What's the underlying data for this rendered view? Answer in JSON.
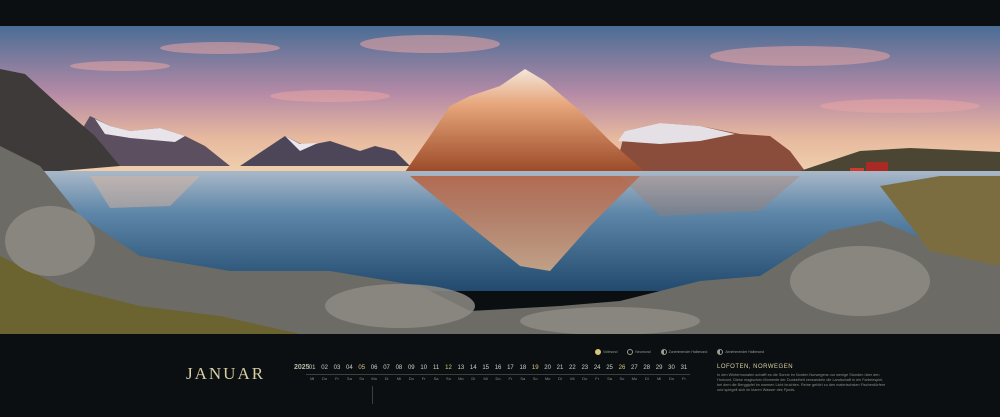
{
  "calendar": {
    "month": "JANUAR",
    "year": "2025",
    "days": [
      {
        "num": "01",
        "dn": "Mi"
      },
      {
        "num": "02",
        "dn": "Do"
      },
      {
        "num": "03",
        "dn": "Fr"
      },
      {
        "num": "04",
        "dn": "Sa"
      },
      {
        "num": "05",
        "dn": "So"
      },
      {
        "num": "06",
        "dn": "Mo"
      },
      {
        "num": "07",
        "dn": "Di"
      },
      {
        "num": "08",
        "dn": "Mi"
      },
      {
        "num": "09",
        "dn": "Do"
      },
      {
        "num": "10",
        "dn": "Fr"
      },
      {
        "num": "11",
        "dn": "Sa"
      },
      {
        "num": "12",
        "dn": "So"
      },
      {
        "num": "13",
        "dn": "Mo"
      },
      {
        "num": "14",
        "dn": "Di"
      },
      {
        "num": "15",
        "dn": "Mi"
      },
      {
        "num": "16",
        "dn": "Do"
      },
      {
        "num": "17",
        "dn": "Fr"
      },
      {
        "num": "18",
        "dn": "Sa"
      },
      {
        "num": "19",
        "dn": "So"
      },
      {
        "num": "20",
        "dn": "Mo"
      },
      {
        "num": "21",
        "dn": "Di"
      },
      {
        "num": "22",
        "dn": "Mi"
      },
      {
        "num": "23",
        "dn": "Do"
      },
      {
        "num": "24",
        "dn": "Fr"
      },
      {
        "num": "25",
        "dn": "Sa"
      },
      {
        "num": "26",
        "dn": "So"
      },
      {
        "num": "27",
        "dn": "Mo"
      },
      {
        "num": "28",
        "dn": "Di"
      },
      {
        "num": "29",
        "dn": "Mi"
      },
      {
        "num": "30",
        "dn": "Do"
      },
      {
        "num": "31",
        "dn": "Fr"
      }
    ],
    "sundays": [
      4,
      11,
      18,
      25
    ]
  },
  "legend": {
    "items": [
      "Vollmond",
      "Neumond",
      "Zunehmender Halbmond",
      "Abnehmender Halbmond"
    ]
  },
  "location": {
    "title": "LOFOTEN, NORWEGEN",
    "text": "In den Wintermonaten schafft es die Sonne im Norden Norwegens nur wenige Stunden über den Horizont. Diese magischen Momente der Dunkelheit verwandeln die Landschaft in ein Farbenspiel, bei dem die Berggipfel im warmen Licht leuchten. Reine gehört zu den malerischsten Fischerdörfern und spiegelt sich im klaren Wasser des Fjords."
  },
  "colors": {
    "background": "#0b0f12",
    "accent": "#d7cfa3"
  }
}
